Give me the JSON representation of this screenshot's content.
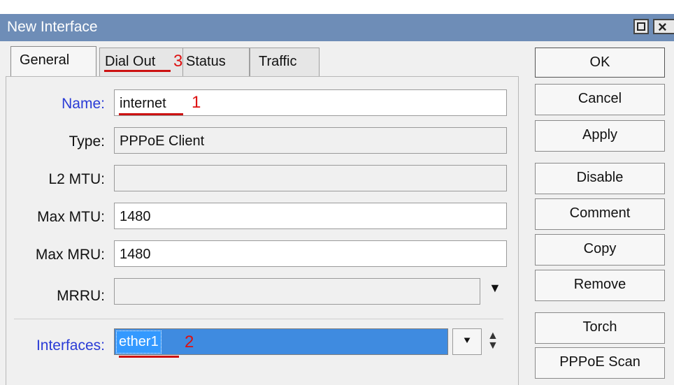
{
  "window": {
    "title": "New Interface"
  },
  "tabs": [
    "General",
    "Dial Out",
    "Status",
    "Traffic"
  ],
  "annotations": {
    "dialout_mark": "3",
    "name_mark": "1",
    "interfaces_mark": "2"
  },
  "form": {
    "name_label": "Name:",
    "name_value": "internet",
    "type_label": "Type:",
    "type_value": "PPPoE Client",
    "l2mtu_label": "L2 MTU:",
    "l2mtu_value": "",
    "maxmtu_label": "Max MTU:",
    "maxmtu_value": "1480",
    "maxmru_label": "Max MRU:",
    "maxmru_value": "1480",
    "mrru_label": "MRRU:",
    "mrru_value": "",
    "interfaces_label": "Interfaces:",
    "interfaces_value": "ether1"
  },
  "buttons": [
    "OK",
    "Cancel",
    "Apply",
    "Disable",
    "Comment",
    "Copy",
    "Remove",
    "Torch",
    "PPPoE Scan"
  ],
  "icons": {
    "dropdown": "▼",
    "picker": "⯆",
    "updown": "▲▼"
  },
  "colors": {
    "titlebar": "#6e8db7",
    "label_blue": "#2a3bd6",
    "selection": "#3399ff",
    "annotation": "#cc1111"
  }
}
